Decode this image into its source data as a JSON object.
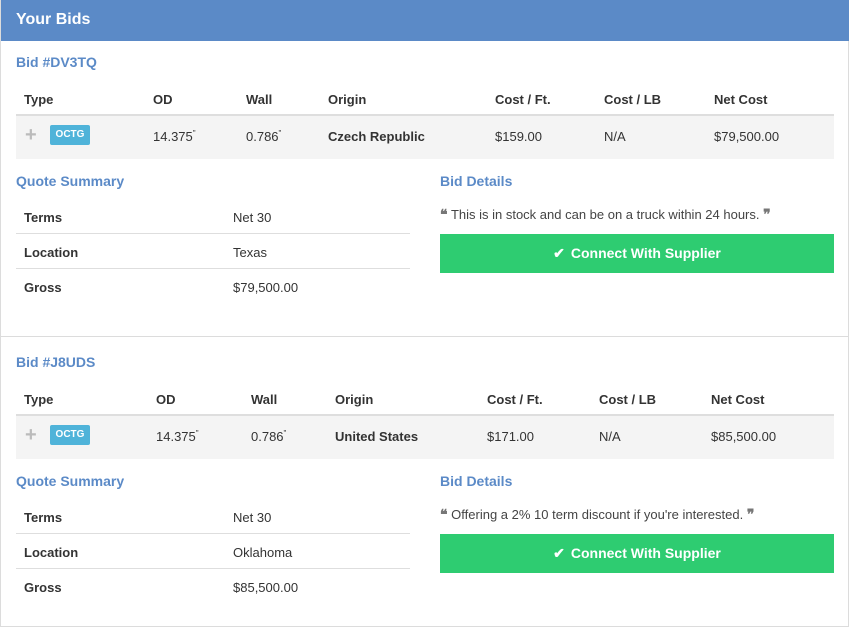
{
  "panel": {
    "title": "Your Bids"
  },
  "bids": [
    {
      "title": "Bid #DV3TQ",
      "headers": {
        "type": "Type",
        "od": "OD",
        "wall": "Wall",
        "origin": "Origin",
        "cost_ft": "Cost / Ft.",
        "cost_lb": "Cost / LB",
        "net_cost": "Net Cost"
      },
      "row": {
        "expand": "+",
        "badge": "OCTG",
        "od": "14.375",
        "od_unit": "\"",
        "wall": "0.786",
        "wall_unit": "\"",
        "origin": "Czech Republic",
        "cost_ft": "$159.00",
        "cost_lb": "N/A",
        "net_cost": "$79,500.00"
      },
      "quote_summary": {
        "title": "Quote Summary",
        "rows": [
          {
            "label": "Terms",
            "value": "Net 30"
          },
          {
            "label": "Location",
            "value": "Texas"
          },
          {
            "label": "Gross",
            "value": "$79,500.00"
          }
        ]
      },
      "bid_details": {
        "title": "Bid Details",
        "open_quote": "❝",
        "close_quote": "❞",
        "text": "This is in stock and can be on a truck within 24 hours.",
        "button_check": "✔",
        "button_label": "Connect With Supplier"
      }
    },
    {
      "title": "Bid #J8UDS",
      "headers": {
        "type": "Type",
        "od": "OD",
        "wall": "Wall",
        "origin": "Origin",
        "cost_ft": "Cost / Ft.",
        "cost_lb": "Cost / LB",
        "net_cost": "Net Cost"
      },
      "row": {
        "expand": "+",
        "badge": "OCTG",
        "od": "14.375",
        "od_unit": "\"",
        "wall": "0.786",
        "wall_unit": "\"",
        "origin": "United States",
        "cost_ft": "$171.00",
        "cost_lb": "N/A",
        "net_cost": "$85,500.00"
      },
      "quote_summary": {
        "title": "Quote Summary",
        "rows": [
          {
            "label": "Terms",
            "value": "Net 30"
          },
          {
            "label": "Location",
            "value": "Oklahoma"
          },
          {
            "label": "Gross",
            "value": "$85,500.00"
          }
        ]
      },
      "bid_details": {
        "title": "Bid Details",
        "open_quote": "❝",
        "close_quote": "❞",
        "text": "Offering a 2% 10 term discount if you're interested.",
        "button_check": "✔",
        "button_label": "Connect With Supplier"
      }
    }
  ],
  "colors": {
    "header": "#5b8ac7",
    "accent_text": "#5b8ac7",
    "badge": "#4fb3d9",
    "button": "#2ecc71"
  }
}
